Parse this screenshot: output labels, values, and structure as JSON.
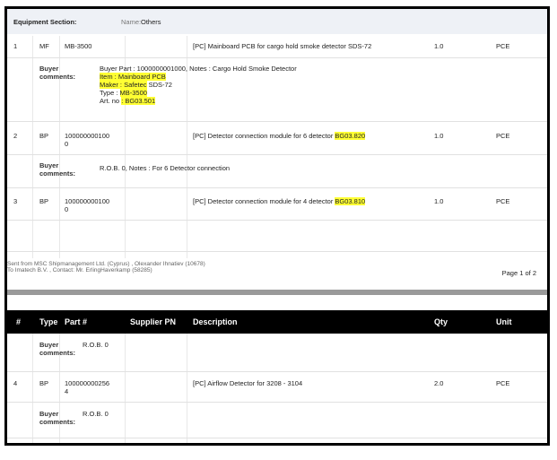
{
  "equipment": {
    "section_label": "Equipment Section:",
    "name_label": "Name:",
    "name_value": "Others"
  },
  "items": [
    {
      "num": "1",
      "type": "MF",
      "part": "MB-3500",
      "supplier_pn": "",
      "description": "[PC] Mainboard PCB for cargo hold smoke detector SDS-72",
      "qty": "1.0",
      "unit": "PCE",
      "comment_label_1": "Buyer",
      "comment_label_2": "comments:",
      "comment_lines": {
        "l1": "Buyer Part : 1000000001000, Notes : Cargo Hold Smoke Detector",
        "l2_hl": "Item : Mainboard PCB",
        "l3_hl": "Maker : Safetec",
        "l3_rest": " SDS-72",
        "l4_pre": "Type : ",
        "l4_hl": "MB-3500",
        "l5_pre": "Art. no ",
        "l5_hl": ": BG03.501"
      }
    },
    {
      "num": "2",
      "type": "BP",
      "part_l1": "100000000100",
      "part_l2": "0",
      "supplier_pn": "",
      "description_pre": "[PC] Detector connection module for 6 detector ",
      "description_hl": "BG03.820",
      "qty": "1.0",
      "unit": "PCE",
      "comment_label_1": "Buyer",
      "comment_label_2": "comments:",
      "comment": "R.O.B. 0, Notes : For 6 Detector connection"
    },
    {
      "num": "3",
      "type": "BP",
      "part_l1": "100000000100",
      "part_l2": "0",
      "supplier_pn": "",
      "description_pre": "[PC] Detector connection module for 4 detector ",
      "description_hl": "BG03.810",
      "qty": "1.0",
      "unit": "PCE"
    }
  ],
  "footer": {
    "line1": "Sent from MSC Shipmanagement Ltd. (Cyprus) , Olexander Ihnatiev (10678)",
    "line2": "To Imatech B.V. , Contact: Mr. ErlingHaverkamp (58285)",
    "page": "Page 1 of 2"
  },
  "table_header": {
    "num": "#",
    "type": "Type",
    "part": "Part #",
    "supplier": "Supplier PN",
    "description": "Description",
    "qty": "Qty",
    "unit": "Unit"
  },
  "page2": {
    "cont_comment_label_1": "Buyer",
    "cont_comment_label_2": "comments:",
    "cont_comment": "R.O.B. 0",
    "item4": {
      "num": "4",
      "type": "BP",
      "part_l1": "100000000256",
      "part_l2": "4",
      "description": "[PC] Airflow Detector for 3208 - 3104",
      "qty": "2.0",
      "unit": "PCE",
      "comment_label_1": "Buyer",
      "comment_label_2": "comments:",
      "comment": "R.O.B. 0"
    }
  },
  "colors": {
    "highlight": "#ffff33",
    "header_bg": "#000000",
    "section_bg": "#eef1f6",
    "divider": "#9a9a9a"
  }
}
